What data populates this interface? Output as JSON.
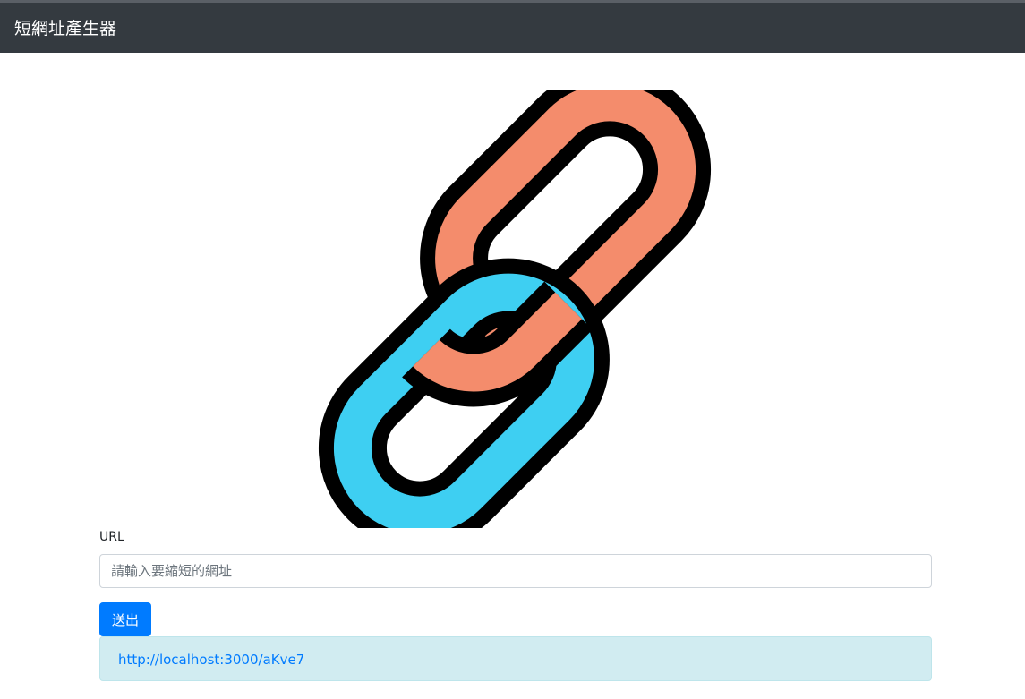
{
  "navbar": {
    "brand": "短網址產生器",
    "background": "#343a40"
  },
  "logo": {
    "icon": "link-chain-icon",
    "colors": {
      "orange_link": "#f48c6c",
      "blue_link": "#3ecff2",
      "outline": "#000000"
    }
  },
  "form": {
    "url_label": "URL",
    "url_placeholder": "請輸入要縮短的網址",
    "url_value": "",
    "submit_label": "送出",
    "submit_color": "#007bff"
  },
  "result": {
    "short_url": "http://localhost:3000/aKve7",
    "background": "#d1ecf1"
  }
}
